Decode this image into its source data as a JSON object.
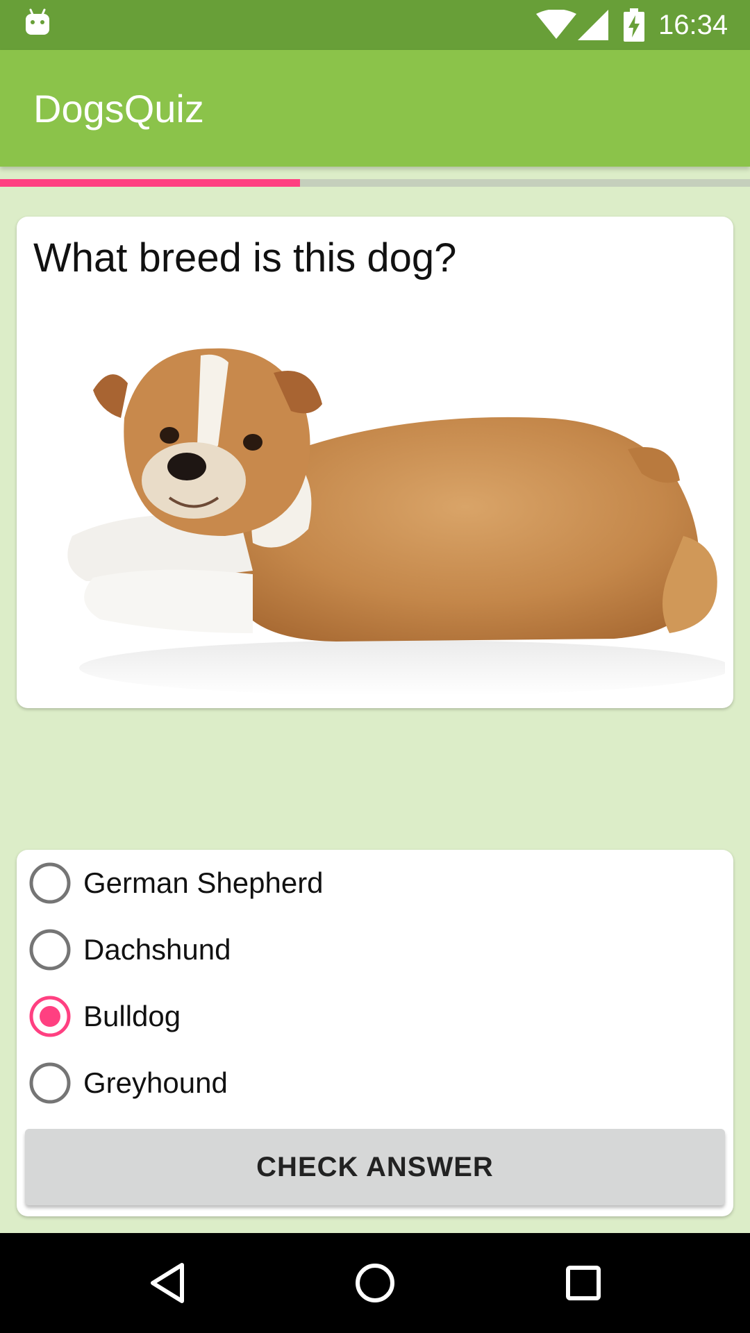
{
  "status_bar": {
    "time": "16:34",
    "icons": [
      "android-debug-icon",
      "wifi-icon",
      "signal-icon",
      "battery-charging-icon"
    ]
  },
  "app_bar": {
    "title": "DogsQuiz"
  },
  "progress": {
    "fraction": 0.4,
    "fill_color": "#ff4081",
    "track_color": "#c5cfbc"
  },
  "question": {
    "text": "What breed is this dog?",
    "image": "bulldog-puppy-photo"
  },
  "answers": {
    "options": [
      {
        "label": "German Shepherd",
        "selected": false
      },
      {
        "label": "Dachshund",
        "selected": false
      },
      {
        "label": "Bulldog",
        "selected": true
      },
      {
        "label": "Greyhound",
        "selected": false
      }
    ],
    "check_button_label": "CHECK ANSWER"
  },
  "nav_bar": {
    "buttons": [
      "back-icon",
      "home-icon",
      "recents-icon"
    ]
  },
  "colors": {
    "primary": "#8bc34a",
    "primary_dark": "#689f38",
    "accent": "#ff4081",
    "background": "#dcedc8"
  }
}
